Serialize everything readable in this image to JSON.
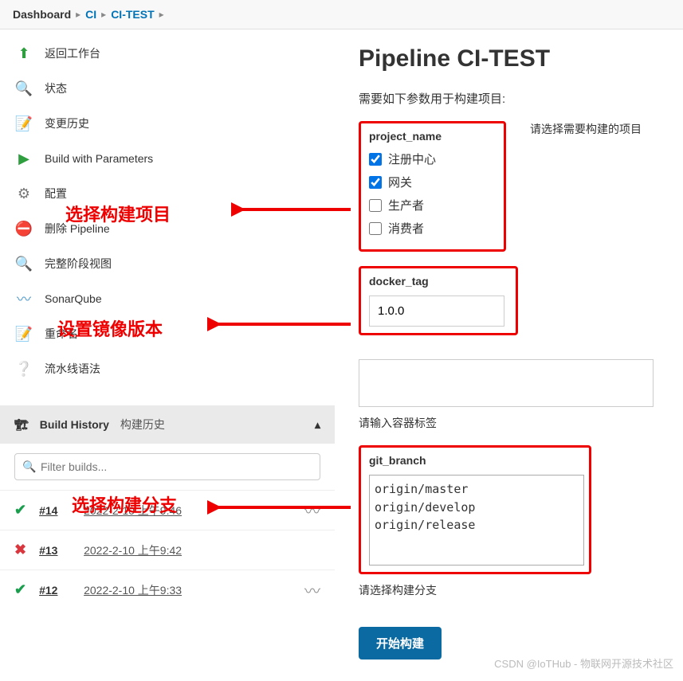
{
  "breadcrumb": {
    "dashboard": "Dashboard",
    "ci": "CI",
    "project": "CI-TEST"
  },
  "sidebar": {
    "items": [
      {
        "label": "返回工作台"
      },
      {
        "label": "状态"
      },
      {
        "label": "变更历史"
      },
      {
        "label": "Build with Parameters"
      },
      {
        "label": "配置"
      },
      {
        "label": "删除 Pipeline"
      },
      {
        "label": "完整阶段视图"
      },
      {
        "label": "SonarQube"
      },
      {
        "label": "重命名"
      },
      {
        "label": "流水线语法"
      }
    ],
    "build_history_label": "Build History",
    "build_history_sublabel": "构建历史"
  },
  "filter": {
    "placeholder": "Filter builds..."
  },
  "builds": [
    {
      "num": "#14",
      "date": "2022-2-10 上午9:46",
      "status": "ok"
    },
    {
      "num": "#13",
      "date": "2022-2-10 上午9:42",
      "status": "fail"
    },
    {
      "num": "#12",
      "date": "2022-2-10 上午9:33",
      "status": "ok"
    }
  ],
  "main": {
    "title": "Pipeline CI-TEST",
    "subtitle": "需要如下参数用于构建项目:",
    "project_name_label": "project_name",
    "project_name_hint": "请选择需要构建的项目",
    "project_options": [
      {
        "label": "注册中心",
        "checked": true
      },
      {
        "label": "网关",
        "checked": true
      },
      {
        "label": "生产者",
        "checked": false
      },
      {
        "label": "消费者",
        "checked": false
      }
    ],
    "docker_tag_label": "docker_tag",
    "docker_tag_value": "1.0.0",
    "docker_tag_hint": "请输入容器标签",
    "git_branch_label": "git_branch",
    "git_branch_options": [
      "origin/master",
      "origin/develop",
      "origin/release"
    ],
    "git_branch_hint": "请选择构建分支",
    "build_button": "开始构建"
  },
  "annotations": {
    "a1": "选择构建项目",
    "a2": "设置镜像版本",
    "a3": "选择构建分支"
  },
  "watermark": "CSDN @IoTHub - 物联网开源技术社区"
}
